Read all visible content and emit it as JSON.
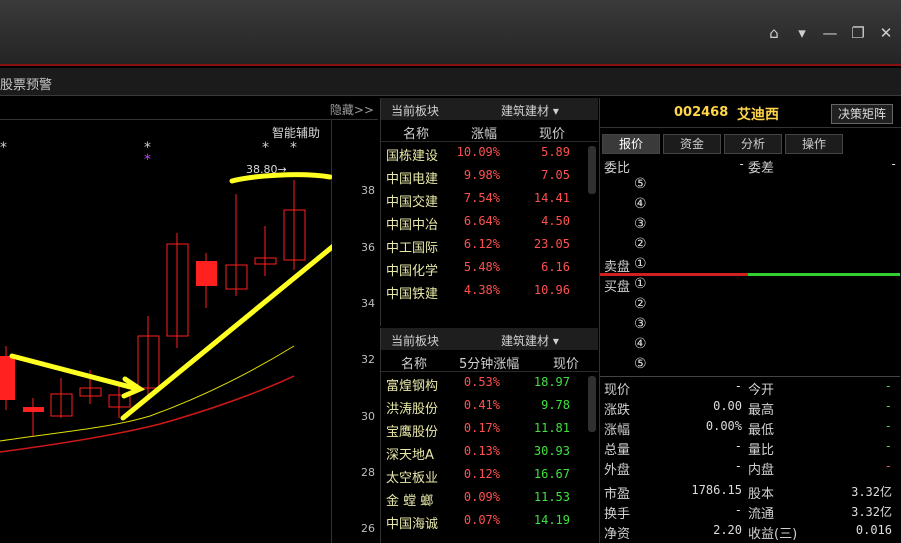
{
  "window": {
    "home": "⌂",
    "menu": "▾",
    "minimize": "—",
    "restore": "❐",
    "close": "✕"
  },
  "toolbar": {
    "alarm": "股票预警"
  },
  "chart": {
    "hide_label": "隐藏>>",
    "smart_assist": "智能辅助",
    "high_marker": "38.80→",
    "yticks": [
      "38",
      "36",
      "34",
      "32",
      "30",
      "28",
      "26"
    ],
    "stars": [
      "*",
      "*",
      "*",
      "*",
      "*"
    ],
    "colors": {
      "up": "#ff3030",
      "down": "#ff2020",
      "ma1": "#e0e000",
      "ma2": "#d01818",
      "annotation": "#ffff22"
    }
  },
  "sector1": {
    "label": "当前板块",
    "select": "建筑建材 ▾",
    "headers": [
      "名称",
      "涨幅",
      "现价"
    ],
    "rows": [
      {
        "name": "国栋建设",
        "pct": "10.09%",
        "price": "5.89"
      },
      {
        "name": "中国电建",
        "pct": "9.98%",
        "price": "7.05"
      },
      {
        "name": "中国交建",
        "pct": "7.54%",
        "price": "14.41"
      },
      {
        "name": "中国中冶",
        "pct": "6.64%",
        "price": "4.50"
      },
      {
        "name": "中工国际",
        "pct": "6.12%",
        "price": "23.05"
      },
      {
        "name": "中国化学",
        "pct": "5.48%",
        "price": "6.16"
      },
      {
        "name": "中国铁建",
        "pct": "4.38%",
        "price": "10.96"
      }
    ]
  },
  "sector2": {
    "label": "当前板块",
    "select": "建筑建材 ▾",
    "headers": [
      "名称",
      "5分钟涨幅",
      "现价"
    ],
    "rows": [
      {
        "name": "富煌钢构",
        "pct": "0.53%",
        "price": "18.97"
      },
      {
        "name": "洪涛股份",
        "pct": "0.41%",
        "price": "9.78"
      },
      {
        "name": "宝鹰股份",
        "pct": "0.17%",
        "price": "11.81"
      },
      {
        "name": "深天地A",
        "pct": "0.13%",
        "price": "30.93"
      },
      {
        "name": "太空板业",
        "pct": "0.12%",
        "price": "16.67"
      },
      {
        "name": "金 螳 螂",
        "pct": "0.09%",
        "price": "11.53"
      },
      {
        "name": "中国海诚",
        "pct": "0.07%",
        "price": "14.19"
      }
    ]
  },
  "quote": {
    "code": "002468",
    "name": "艾迪西",
    "matrix_btn": "决策矩阵",
    "tabs": [
      "报价",
      "资金",
      "分析",
      "操作"
    ],
    "weibi": "委比",
    "weibi_val": "-",
    "weicha": "委差",
    "weicha_val": "-",
    "sell_levels": [
      "⑤",
      "④",
      "③",
      "②",
      "①"
    ],
    "sell_label": "卖盘",
    "buy_label": "买盘",
    "buy_levels": [
      "①",
      "②",
      "③",
      "④",
      "⑤"
    ],
    "stats": [
      {
        "l1": "现价",
        "v1": "-",
        "l2": "今开",
        "v2": "-"
      },
      {
        "l1": "涨跌",
        "v1": "0.00",
        "l2": "最高",
        "v2": "-"
      },
      {
        "l1": "涨幅",
        "v1": "0.00%",
        "l2": "最低",
        "v2": "-"
      },
      {
        "l1": "总量",
        "v1": "-",
        "l2": "量比",
        "v2": "-"
      },
      {
        "l1": "外盘",
        "v1": "-",
        "l2": "内盘",
        "v2": "-"
      },
      {
        "l1": "市盈",
        "v1": "1786.15",
        "l2": "股本",
        "v2": "3.32亿"
      },
      {
        "l1": "换手",
        "v1": "-",
        "l2": "流通",
        "v2": "3.32亿"
      },
      {
        "l1": "净资",
        "v1": "2.20",
        "l2": "收益(三)",
        "v2": "0.016"
      }
    ]
  }
}
